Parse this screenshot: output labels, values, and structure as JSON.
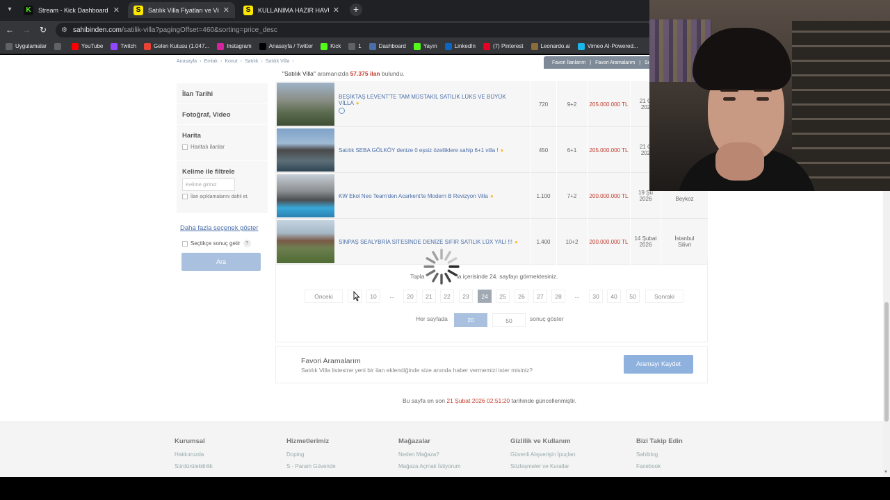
{
  "browser": {
    "tabs": [
      {
        "label": "Stream - Kick Dashboard",
        "favicon": "K"
      },
      {
        "label": "Satılık Villa Fiyatları ve Villa İlanl",
        "favicon": "S"
      },
      {
        "label": "KULLANIMA HAZIR HAVUZLU S",
        "favicon": "S"
      }
    ],
    "url_host": "sahibinden.com",
    "url_path": "/satilik-villa?pagingOffset=460&sorting=price_desc",
    "bookmarks": [
      {
        "label": "Uygulamalar",
        "icon": "apps-icon",
        "color": "#5f6368"
      },
      {
        "label": "",
        "icon": "grid-icon",
        "color": "#5f6368"
      },
      {
        "label": "YouTube",
        "icon": "youtube-icon",
        "color": "#ff0000"
      },
      {
        "label": "Twitch",
        "icon": "twitch-icon",
        "color": "#9146ff"
      },
      {
        "label": "Gelen Kutusu (1.047...",
        "icon": "gmail-icon",
        "color": "#ea4335"
      },
      {
        "label": "Instagram",
        "icon": "instagram-icon",
        "color": "#d6249f"
      },
      {
        "label": "Anasayfa / Twitter",
        "icon": "x-icon",
        "color": "#000000"
      },
      {
        "label": "Kick",
        "icon": "kick-icon",
        "color": "#53fc18"
      },
      {
        "label": "1",
        "icon": "folder-icon",
        "color": "#5f6368"
      },
      {
        "label": "Dashboard",
        "icon": "dashboard-icon",
        "color": "#4a6ea9"
      },
      {
        "label": "Yayın",
        "icon": "kick-icon",
        "color": "#53fc18"
      },
      {
        "label": "LinkedIn",
        "icon": "linkedin-icon",
        "color": "#0a66c2"
      },
      {
        "label": "(7) Pinterest",
        "icon": "pinterest-icon",
        "color": "#e60023"
      },
      {
        "label": "Leonardo.ai",
        "icon": "leonardo-icon",
        "color": "#8a6d3b"
      },
      {
        "label": "Vimeo AI-Powered...",
        "icon": "vimeo-icon",
        "color": "#1ab7ea"
      }
    ]
  },
  "page": {
    "breadcrumb": [
      "Anasayfa",
      "Emlak",
      "Konut",
      "Satılık",
      "Satılık Villa"
    ],
    "fav_links": [
      "Favori İlanlarım",
      "|",
      "Favori Aramalarım",
      "|",
      "Sı"
    ],
    "search_term": "\"Satılık Villa\"",
    "search_mid": "aramanızda",
    "result_count": "57.375 ilan",
    "search_suffix": "bulundu.",
    "sidebar": {
      "date_label": "İlan Tarihi",
      "photo_label": "Fotoğraf, Video",
      "map_label": "Harita",
      "map_check": "Haritalı ilanlar",
      "keyword_label": "Kelime ile filtrele",
      "keyword_placeholder": "Kelime giriniz",
      "desc_check": "İlan açıklamalarını dahil et.",
      "more_link": "Daha fazla seçenek göster",
      "step_check": "Seçtikçe sonuç getir",
      "help": "?",
      "search_button": "Ara"
    },
    "listings": [
      {
        "title": "BEŞİKTAŞ LEVENT'TE TAM MÜSTAKİL SATILIK LÜKS VE BÜYÜK VİLLA",
        "m2": "720",
        "rooms": "9+2",
        "price": "205.000.000 TL",
        "date1": "21 O",
        "date2": "202",
        "loc1": "",
        "loc2": "",
        "has_video": true
      },
      {
        "title": "Satılık SEBA GÖLKÖY denize 0 eşsiz özelliklere sahip 6+1 villa !",
        "m2": "450",
        "rooms": "6+1",
        "price": "205.000.000 TL",
        "date1": "21 O",
        "date2": "202",
        "loc1": "",
        "loc2": "",
        "has_video": false
      },
      {
        "title": "KW Ekol Neo Team'den Acarkent'te Modern B Revizyon Villa",
        "m2": "1.100",
        "rooms": "7+2",
        "price": "200.000.000 TL",
        "date1": "19 Şu",
        "date2": "2026",
        "loc1": "",
        "loc2": "Beykoz",
        "has_video": false
      },
      {
        "title": "SİNPAŞ SEALYBRİA SİTESİNDE DENİZE SIFIR SATILIK LÜX YALI !!!",
        "m2": "1.400",
        "rooms": "10+2",
        "price": "200.000.000 TL",
        "date1": "14 Şubat",
        "date2": "2026",
        "loc1": "İstanbul",
        "loc2": "Silivri",
        "has_video": false
      }
    ],
    "pagination": {
      "total_prefix": "Topla",
      "total_suffix": "fa içerisinde 24. sayfayı görmektesiniz.",
      "prev": "Önceki",
      "next": "Sonraki",
      "pages": [
        "",
        "10",
        "...",
        "20",
        "21",
        "22",
        "23",
        "24",
        "25",
        "26",
        "27",
        "28",
        "...",
        "30",
        "40",
        "50"
      ],
      "current": "24",
      "per_page_label": "Her sayfada",
      "per_page_options": [
        "20",
        "50"
      ],
      "per_page_selected": "20",
      "per_page_suffix": "sonuç göster"
    },
    "fav_search": {
      "title": "Favori Aramalarım",
      "desc": "Satılık Villa listesine yeni bir ilan eklendiğinde size anında haber vermemizi ister misiniz?",
      "button": "Aramayı Kaydet"
    },
    "updated": {
      "prefix": "Bu sayfa en son",
      "date": "21 Şubat 2026 02:51:20",
      "suffix": "tarihinde güncellenmiştir."
    },
    "footer": [
      {
        "title": "Kurumsal",
        "items": [
          "Hakkımızda",
          "Sürdürülebilirlik"
        ]
      },
      {
        "title": "Hizmetlerimiz",
        "items": [
          "Doping",
          "S - Param Güvende"
        ]
      },
      {
        "title": "Mağazalar",
        "items": [
          "Neden Mağaza?",
          "Mağaza Açmak İstiyorum"
        ]
      },
      {
        "title": "Gizlilik ve Kullanım",
        "items": [
          "Güvenli Alışverişin İpuçları",
          "Sözleşmeler ve Kurallar"
        ]
      },
      {
        "title": "Bizi Takip Edin",
        "items": [
          "Sahiblog",
          "Facebook"
        ]
      }
    ]
  }
}
